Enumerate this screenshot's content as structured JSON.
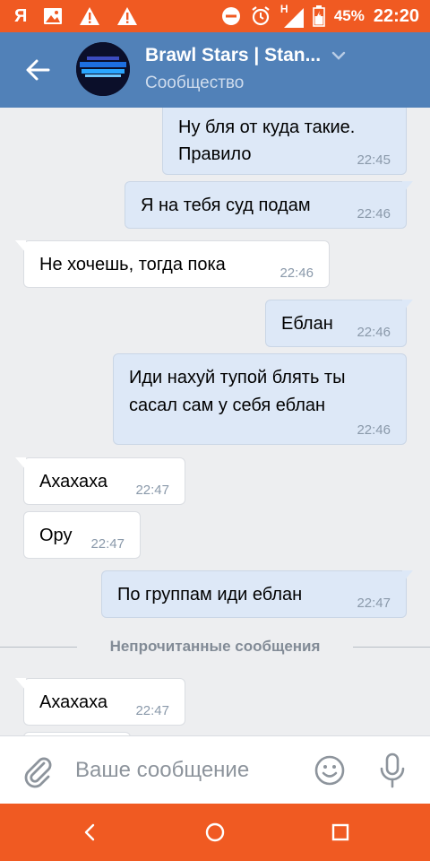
{
  "status_bar": {
    "app_glyph": "Я",
    "battery_percent": "45%",
    "time": "22:20",
    "network": "H"
  },
  "header": {
    "title": "Brawl Stars | Stan...",
    "subtitle": "Сообщество"
  },
  "messages": [
    {
      "direction": "out",
      "lines": [
        "Ну бля от куда такие.",
        "Правило"
      ],
      "time": "22:45"
    },
    {
      "direction": "out",
      "lines": [
        "Я на тебя суд подам"
      ],
      "time": "22:46"
    },
    {
      "direction": "in",
      "lines": [
        "Не хочешь, тогда пока"
      ],
      "time": "22:46"
    },
    {
      "direction": "out",
      "lines": [
        "Еблан"
      ],
      "time": "22:46"
    },
    {
      "direction": "out",
      "lines": [
        "Иди нахуй тупой блять ты",
        "сасал сам у себя еблан"
      ],
      "time": "22:46"
    },
    {
      "direction": "in",
      "lines": [
        "Ахахаха"
      ],
      "time": "22:47"
    },
    {
      "direction": "in",
      "lines": [
        "Ору"
      ],
      "time": "22:47"
    },
    {
      "direction": "out",
      "lines": [
        "По группам иди еблан"
      ],
      "time": "22:47"
    },
    {
      "direction": "in",
      "lines": [
        "Ахахаха"
      ],
      "time": "22:47"
    }
  ],
  "divider_text": "Непрочитанные сообщения",
  "input": {
    "placeholder": "Ваше сообщение",
    "value": ""
  },
  "colors": {
    "status_bar": "#f05a22",
    "header": "#5181b8",
    "background": "#edeef0",
    "bubble_out": "#dde8f7",
    "bubble_in": "#ffffff"
  }
}
